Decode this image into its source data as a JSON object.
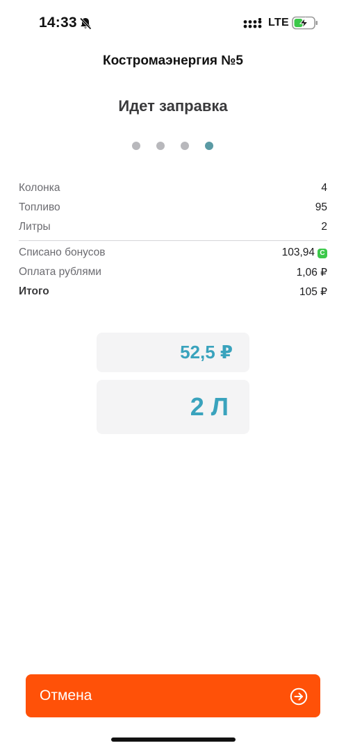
{
  "status_bar": {
    "time": "14:33",
    "network": "LTE",
    "icons": [
      "bell-slash-icon",
      "signal-icon",
      "battery-charging-icon"
    ],
    "battery_color": "#3cc84a"
  },
  "header": {
    "station": "Костромаэнергия №5",
    "title": "Идет заправка"
  },
  "steps": {
    "count": 4,
    "active_index": 3,
    "active_color": "#5a9aa4"
  },
  "details": {
    "pump_label": "Колонка",
    "pump_value": "4",
    "fuel_label": "Топливо",
    "fuel_value": "95",
    "liters_label": "Литры",
    "liters_value": "2",
    "bonus_label": "Списано бонусов",
    "bonus_value": "103,94",
    "bonus_badge": "С",
    "rubles_label": "Оплата рублями",
    "rubles_value": "1,06 ₽",
    "total_label": "Итого",
    "total_value": "105 ₽"
  },
  "progress": {
    "amount": "52,5 ₽",
    "liters": "2 Л",
    "accent_color": "#3aa3bd"
  },
  "actions": {
    "cancel_label": "Отмена",
    "cancel_color": "#ff5108"
  }
}
